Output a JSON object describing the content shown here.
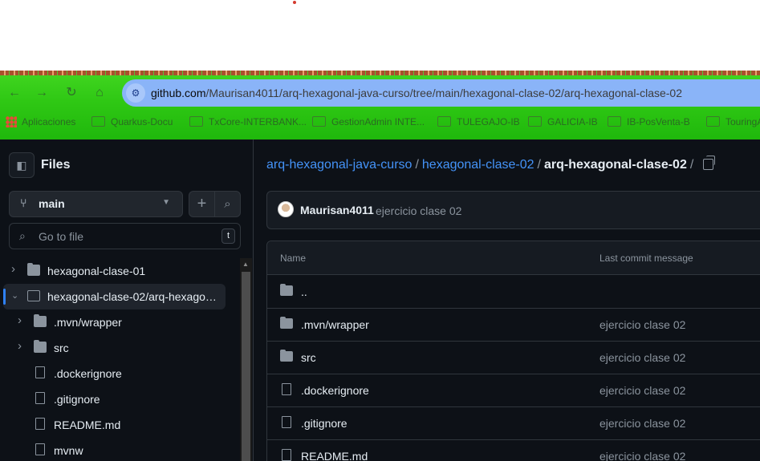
{
  "browser": {
    "url_host": "github.com",
    "url_path": "/Maurisan4011/arq-hexagonal-java-curso/tree/main/hexagonal-clase-02/arq-hexagonal-clase-02",
    "nav": {
      "back": "←",
      "forward": "→",
      "reload": "↻",
      "home": "⌂",
      "site_info": "⚙"
    }
  },
  "bookmarks": [
    {
      "label": "Aplicaciones",
      "icon": "apps-grid-icon"
    },
    {
      "label": "Quarkus-Docu",
      "icon": "folder-icon"
    },
    {
      "label": "TxCore-INTERBANK...",
      "icon": "folder-icon"
    },
    {
      "label": "GestionAdmin INTE...",
      "icon": "folder-icon"
    },
    {
      "label": "TULEGAJO-IB",
      "icon": "folder-icon"
    },
    {
      "label": "GALICIA-IB",
      "icon": "folder-icon"
    },
    {
      "label": "IB-PosVenta-B",
      "icon": "folder-icon"
    },
    {
      "label": "TouringA",
      "icon": "folder-icon"
    }
  ],
  "sidebar": {
    "title": "Files",
    "branch": "main",
    "goto_placeholder": "Go to file",
    "goto_shortcut": "t",
    "tree": [
      {
        "label": "hexagonal-clase-01",
        "type": "folder",
        "expanded": false,
        "depth": 0
      },
      {
        "label": "hexagonal-clase-02/arq-hexagon...",
        "type": "folder",
        "expanded": true,
        "depth": 0,
        "selected": true
      },
      {
        "label": ".mvn/wrapper",
        "type": "folder",
        "expanded": false,
        "depth": 1
      },
      {
        "label": "src",
        "type": "folder",
        "expanded": false,
        "depth": 1
      },
      {
        "label": ".dockerignore",
        "type": "file",
        "depth": 1
      },
      {
        "label": ".gitignore",
        "type": "file",
        "depth": 1
      },
      {
        "label": "README.md",
        "type": "file",
        "depth": 1
      },
      {
        "label": "mvnw",
        "type": "file",
        "depth": 1
      }
    ]
  },
  "breadcrumb": {
    "repo": "arq-hexagonal-java-curso",
    "folder": "hexagonal-clase-02",
    "current": "arq-hexagonal-clase-02",
    "sep": "/"
  },
  "commit": {
    "author": "Maurisan4011",
    "message": "ejercicio clase 02"
  },
  "table": {
    "headers": {
      "name": "Name",
      "last_commit": "Last commit message"
    },
    "rows": [
      {
        "name": "..",
        "type": "folder",
        "msg": ""
      },
      {
        "name": ".mvn/wrapper",
        "type": "folder",
        "msg": "ejercicio clase 02"
      },
      {
        "name": "src",
        "type": "folder",
        "msg": "ejercicio clase 02"
      },
      {
        "name": ".dockerignore",
        "type": "file",
        "msg": "ejercicio clase 02"
      },
      {
        "name": ".gitignore",
        "type": "file",
        "msg": "ejercicio clase 02"
      },
      {
        "name": "README.md",
        "type": "file",
        "msg": "ejercicio clase 02"
      }
    ]
  }
}
